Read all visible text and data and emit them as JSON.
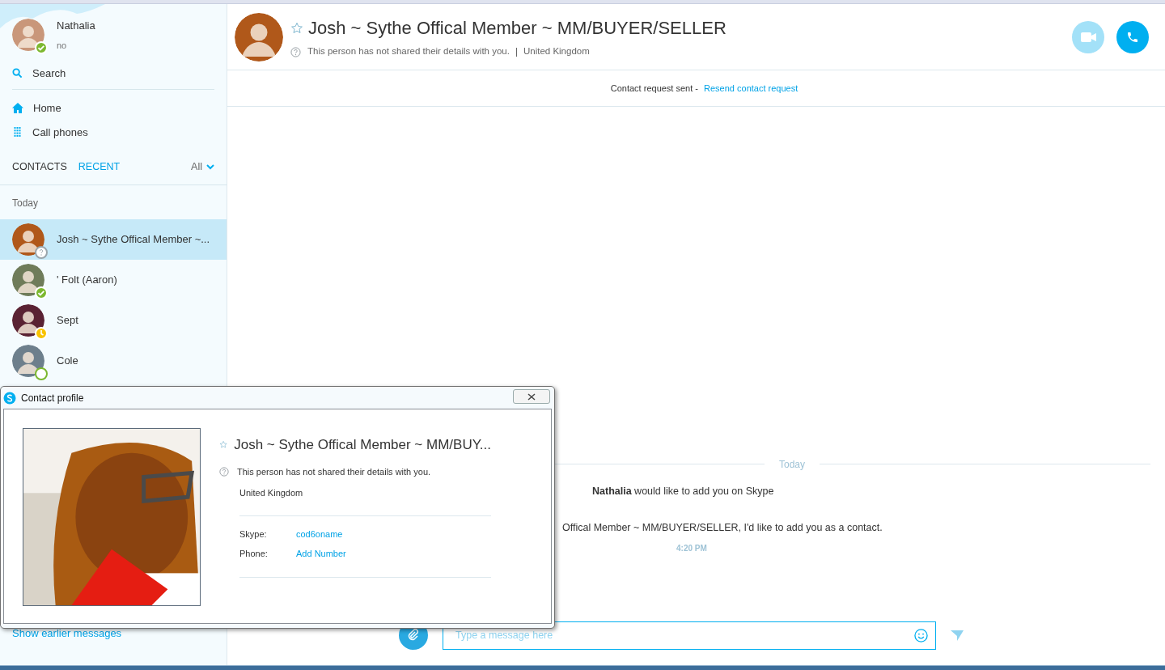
{
  "profile": {
    "name": "Nathalia",
    "mood": "no",
    "kind": "online"
  },
  "nav": {
    "search": "Search",
    "items": [
      {
        "label": "Home",
        "kind": "home"
      },
      {
        "label": "Call phones",
        "kind": "dialpad"
      }
    ]
  },
  "tabs": [
    {
      "label": "CONTACTS",
      "selected": false
    },
    {
      "label": "RECENT",
      "selected": true
    }
  ],
  "filter": "All",
  "section": "Today",
  "contacts": [
    {
      "name": "Josh ~ Sythe Offical Member ~...",
      "kind": "unknown",
      "selected": true
    },
    {
      "name": "' Folt (Aaron)",
      "kind": "online",
      "selected": false
    },
    {
      "name": "Sept",
      "kind": "away",
      "selected": false
    },
    {
      "name": "Cole",
      "kind": "offline",
      "selected": false
    }
  ],
  "show_earlier": "Show earlier messages",
  "conversation": {
    "title": "Josh ~ Sythe Offical Member ~ MM/BUYER/SELLER",
    "details": "This person has not shared their details with you.",
    "location": "United Kingdom",
    "video_disabled": true,
    "notice": "Contact request sent - ",
    "notice_link": "Resend contact request",
    "day": "Today",
    "messages": [
      {
        "text": "**Nathalia** would like to add you on Skype"
      },
      {
        "text": "Offical Member ~ MM/BUYER/SELLER, I'd like to add you as a contact."
      }
    ],
    "time": "4:20 PM",
    "composer": {
      "placeholder": "Type a message here"
    }
  },
  "dialog": {
    "title": "Contact profile",
    "name": "Josh ~ Sythe Offical Member ~ MM/BUY...",
    "details": "This person has not shared their details with you.",
    "location": "United Kingdom",
    "fields": [
      {
        "label": "Skype:",
        "value": "cod6oname"
      },
      {
        "label": "Phone:",
        "value": "Add Number"
      }
    ]
  }
}
